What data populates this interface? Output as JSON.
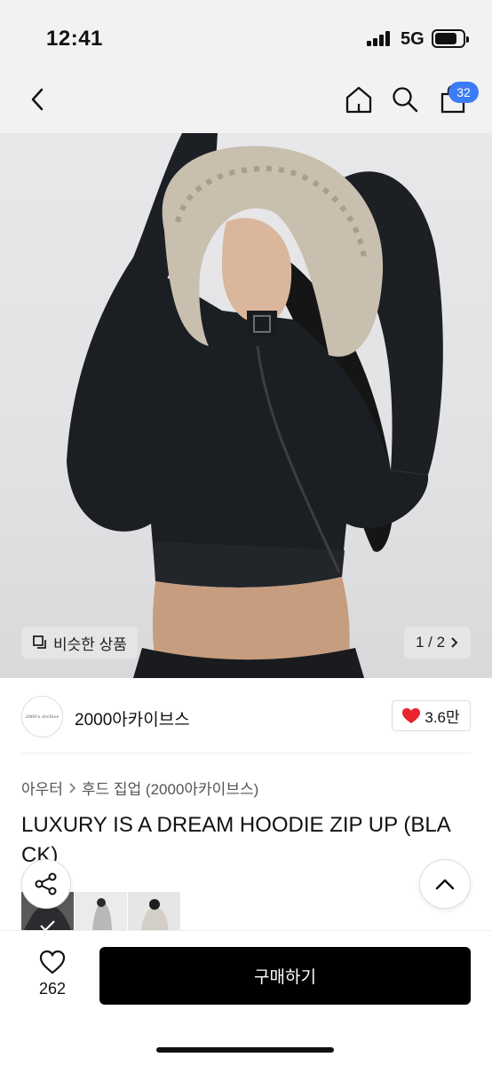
{
  "status_bar": {
    "time": "12:41",
    "network": "5G"
  },
  "nav": {
    "cart_count": "32",
    "icons": [
      "back-icon",
      "home-icon",
      "search-icon",
      "cart-icon"
    ]
  },
  "image": {
    "similar_label": "비슷한 상품",
    "page_indicator": "1 / 2"
  },
  "seller": {
    "logo_text": "2000's Archive",
    "name": "2000아카이브스",
    "likes": "3.6만"
  },
  "breadcrumb": {
    "category": "아우터",
    "subcategory": "후드 집업 (2000아카이브스)"
  },
  "product": {
    "title": "LUXURY IS A DREAM HOODIE ZIP UP (BLACK)"
  },
  "bottom": {
    "wish_count": "262",
    "buy_label": "구매하기"
  },
  "colors": {
    "badge": "#3d7bf6",
    "like_heart": "#e8242f",
    "buy_button": "#000000"
  }
}
